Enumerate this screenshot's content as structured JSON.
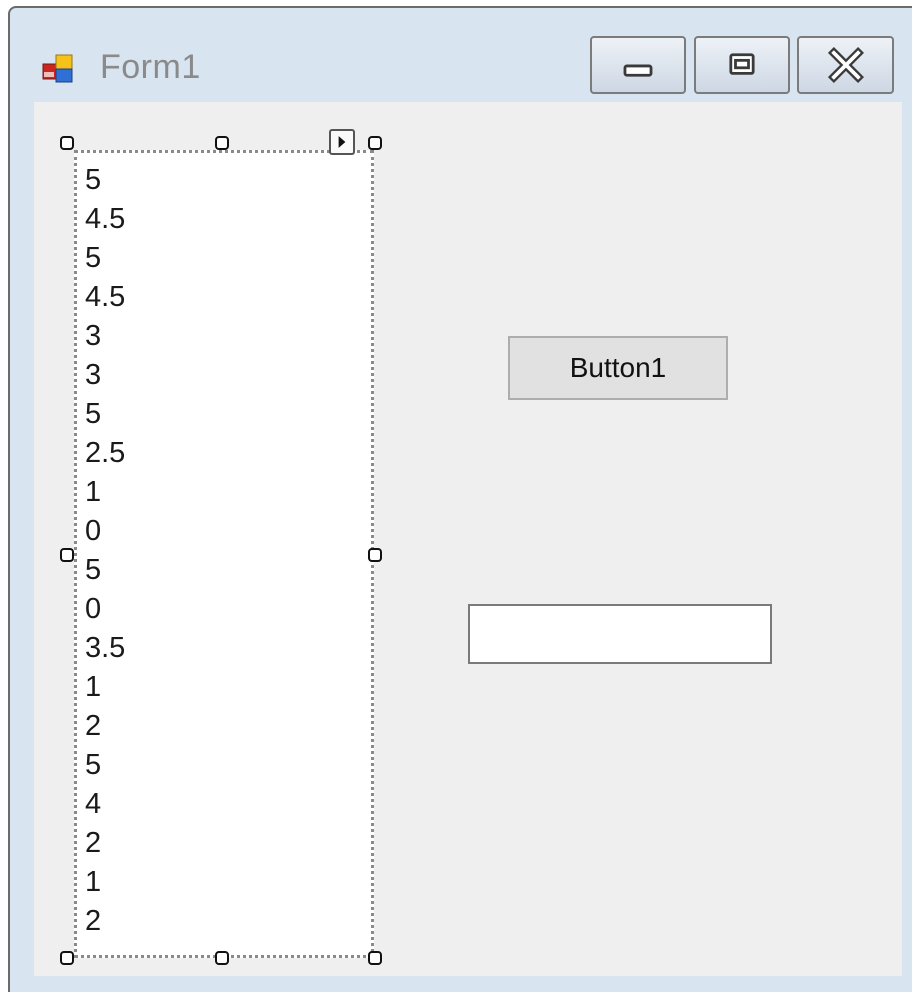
{
  "window": {
    "title": "Form1",
    "icon": "form-app-icon",
    "controls": {
      "minimize_icon": "minimize-icon",
      "maximize_icon": "maximize-icon",
      "close_icon": "close-icon"
    }
  },
  "listbox": {
    "items": [
      "5",
      "4.5",
      "5",
      "4.5",
      "3",
      "3",
      "5",
      "2.5",
      "1",
      "0",
      "5",
      "0",
      "3.5",
      "1",
      "2",
      "5",
      "4",
      "2",
      "1",
      "2"
    ]
  },
  "button1": {
    "label": "Button1"
  },
  "textbox": {
    "value": ""
  },
  "colors": {
    "titlebar": "#d9e4f1",
    "client": "#efefef",
    "button_face": "#e1e1e1"
  }
}
